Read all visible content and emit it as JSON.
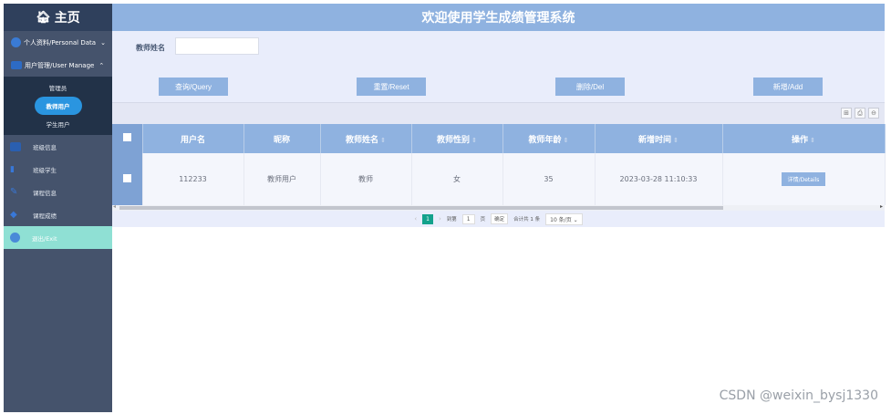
{
  "sidebar": {
    "brand": "主页",
    "personal": "个人资料/Personal Data",
    "user_manage": "用户管理/User Manage",
    "sub_items": [
      "管理员",
      "教师用户",
      "学生用户"
    ],
    "items": [
      "班级信息",
      "班级学生",
      "课程信息",
      "课程成绩",
      "退出/Exit"
    ]
  },
  "header": {
    "title": "欢迎使用学生成绩管理系统"
  },
  "search": {
    "label": "教师姓名",
    "value": "",
    "query": "查询/Query",
    "reset": "重置/Reset",
    "del": "删除/Del",
    "add": "新增/Add"
  },
  "table": {
    "columns": [
      "用户名",
      "昵称",
      "教师姓名",
      "教师性别",
      "教师年龄",
      "新增时间",
      "操作"
    ],
    "rows": [
      [
        "112233",
        "教师用户",
        "教师",
        "女",
        "35",
        "2023-03-28 11:10:33",
        "详情/Details"
      ]
    ]
  },
  "pager": {
    "current": "1",
    "goto": "到第",
    "page_input": "1",
    "page_unit": "页",
    "confirm": "确定",
    "total": "合计共 1 条",
    "per_page": "10 条/页"
  },
  "watermark": "CSDN @weixin_bysj1330"
}
